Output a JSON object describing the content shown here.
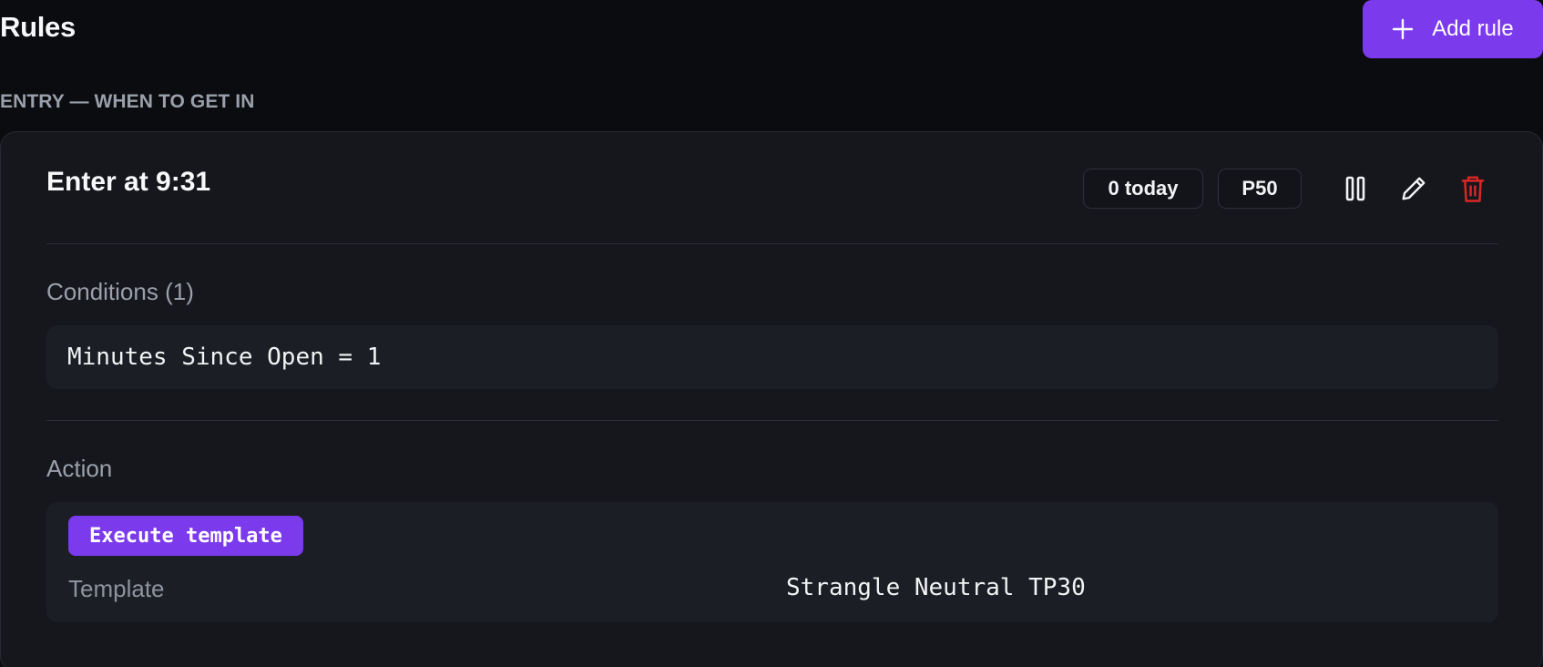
{
  "header": {
    "title": "Rules",
    "add_button_label": "Add rule"
  },
  "section": {
    "label": "ENTRY — WHEN TO GET IN"
  },
  "rule": {
    "title": "Enter at 9:31",
    "badges": {
      "count": "0 today",
      "priority": "P50"
    },
    "icons": {
      "pause": "pause-icon",
      "edit": "pencil-icon",
      "delete": "trash-icon"
    },
    "conditions": {
      "heading": "Conditions (1)",
      "items": [
        "Minutes Since Open = 1"
      ]
    },
    "action": {
      "heading": "Action",
      "type_label": "Execute template",
      "template_label": "Template",
      "template_value": "Strangle Neutral TP30"
    }
  },
  "colors": {
    "accent": "#7c3aed",
    "background": "#0b0c0f",
    "card": "#15171c",
    "danger": "#dc2626"
  }
}
